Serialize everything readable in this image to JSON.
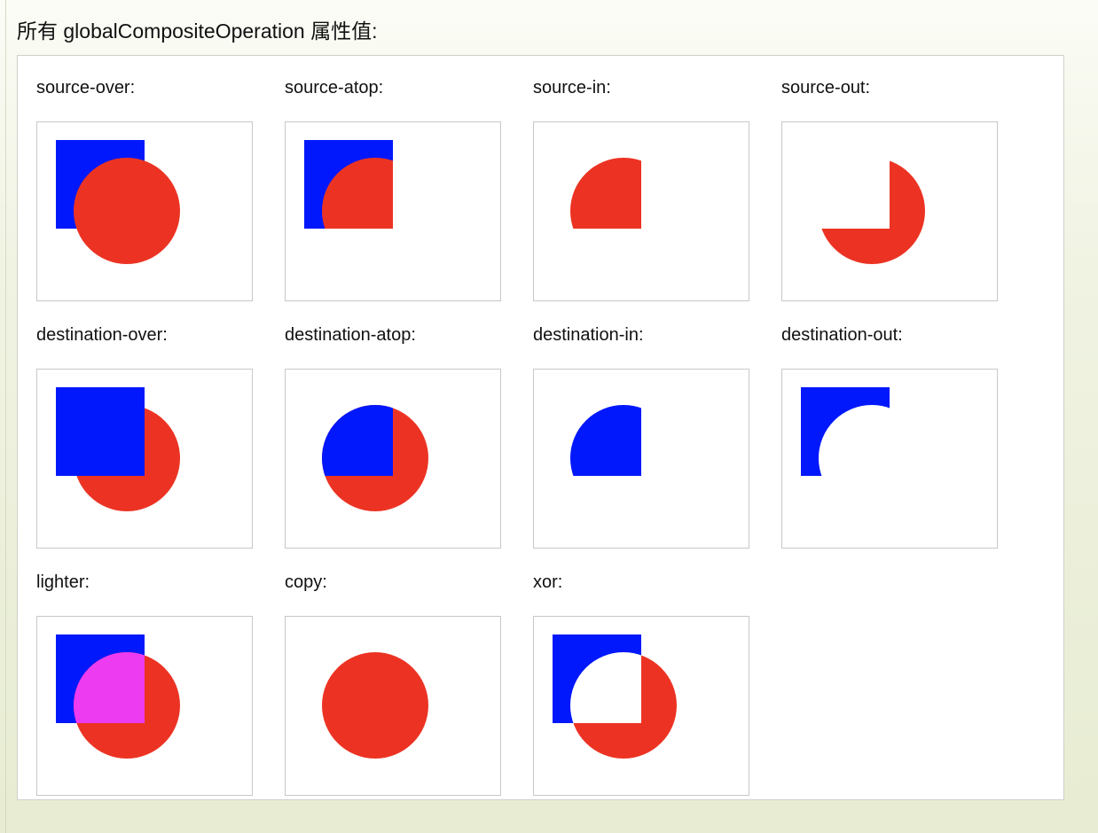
{
  "title": "所有 globalCompositeOperation 属性值:",
  "colors": {
    "square": "#0018fb",
    "circle": "#ec3323",
    "lighter_overlap": "#ec3bf0"
  },
  "operations": [
    {
      "label": "source-over:",
      "op": "source-over"
    },
    {
      "label": "source-atop:",
      "op": "source-atop"
    },
    {
      "label": "source-in:",
      "op": "source-in"
    },
    {
      "label": "source-out:",
      "op": "source-out"
    },
    {
      "label": "destination-over:",
      "op": "destination-over"
    },
    {
      "label": "destination-atop:",
      "op": "destination-atop"
    },
    {
      "label": "destination-in:",
      "op": "destination-in"
    },
    {
      "label": "destination-out:",
      "op": "destination-out"
    },
    {
      "label": "lighter:",
      "op": "lighter"
    },
    {
      "label": "copy:",
      "op": "copy"
    },
    {
      "label": "xor:",
      "op": "xor"
    }
  ]
}
